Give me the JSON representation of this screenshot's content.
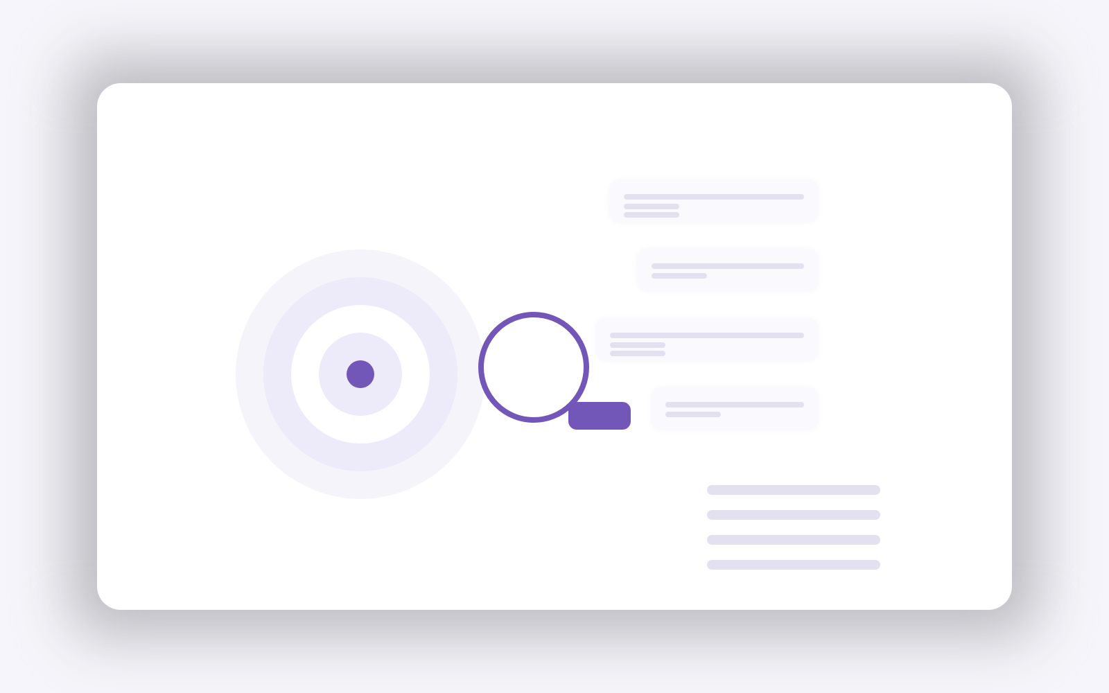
{
  "illustration": {
    "target_icon": "target-icon",
    "magnifier_icon": "magnifying-glass-icon"
  },
  "colors": {
    "background": "#f5f5fb",
    "card": "#ffffff",
    "accent": "#7256b8",
    "ring_light": "#f5f4fb",
    "ring_mid": "#edeafa",
    "placeholder": "#e3e1ef",
    "result_card": "#fafafe"
  },
  "result_cards": [
    {
      "name": "result-card-1",
      "text_lines": 3
    },
    {
      "name": "result-card-2",
      "text_lines": 2
    },
    {
      "name": "result-card-3",
      "text_lines": 3
    },
    {
      "name": "result-card-4",
      "text_lines": 2
    }
  ],
  "text_placeholders": 4
}
